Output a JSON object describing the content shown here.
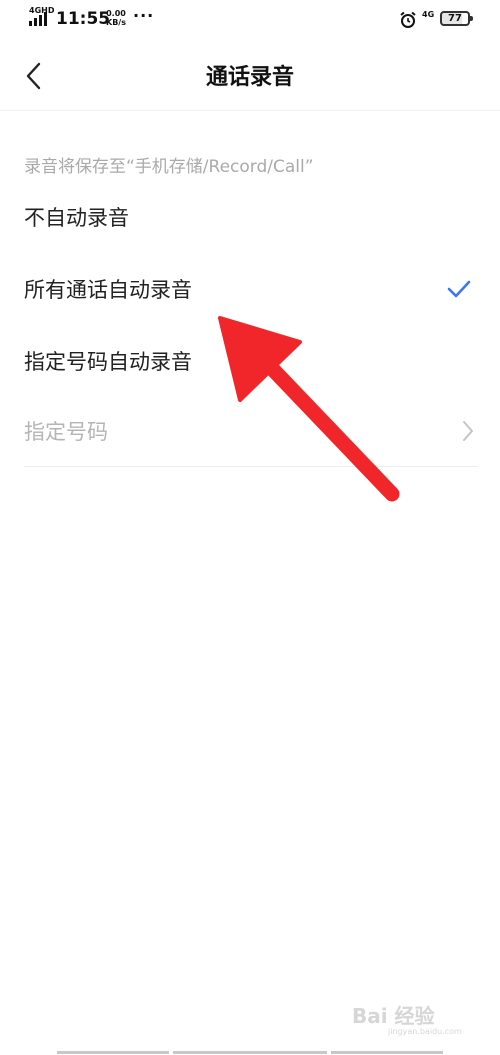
{
  "status_bar": {
    "network": "4GHD",
    "time": "11:55",
    "speed_value": "0.00",
    "speed_unit": "KB/s",
    "dots": "···",
    "network_right": "4G",
    "battery": "77"
  },
  "header": {
    "title": "通话录音"
  },
  "hint": "录音将保存至“手机存储/Record/Call”",
  "options": [
    {
      "label": "不自动录音",
      "selected": false
    },
    {
      "label": "所有通话自动录音",
      "selected": true
    },
    {
      "label": "指定号码自动录音",
      "selected": false
    },
    {
      "label": "指定号码",
      "disabled": true
    }
  ],
  "colors": {
    "accent": "#3a78f0",
    "annotation": "#f0262a"
  },
  "watermark": {
    "text": "Bai 经验",
    "sub": "jingyan.baidu.com"
  }
}
